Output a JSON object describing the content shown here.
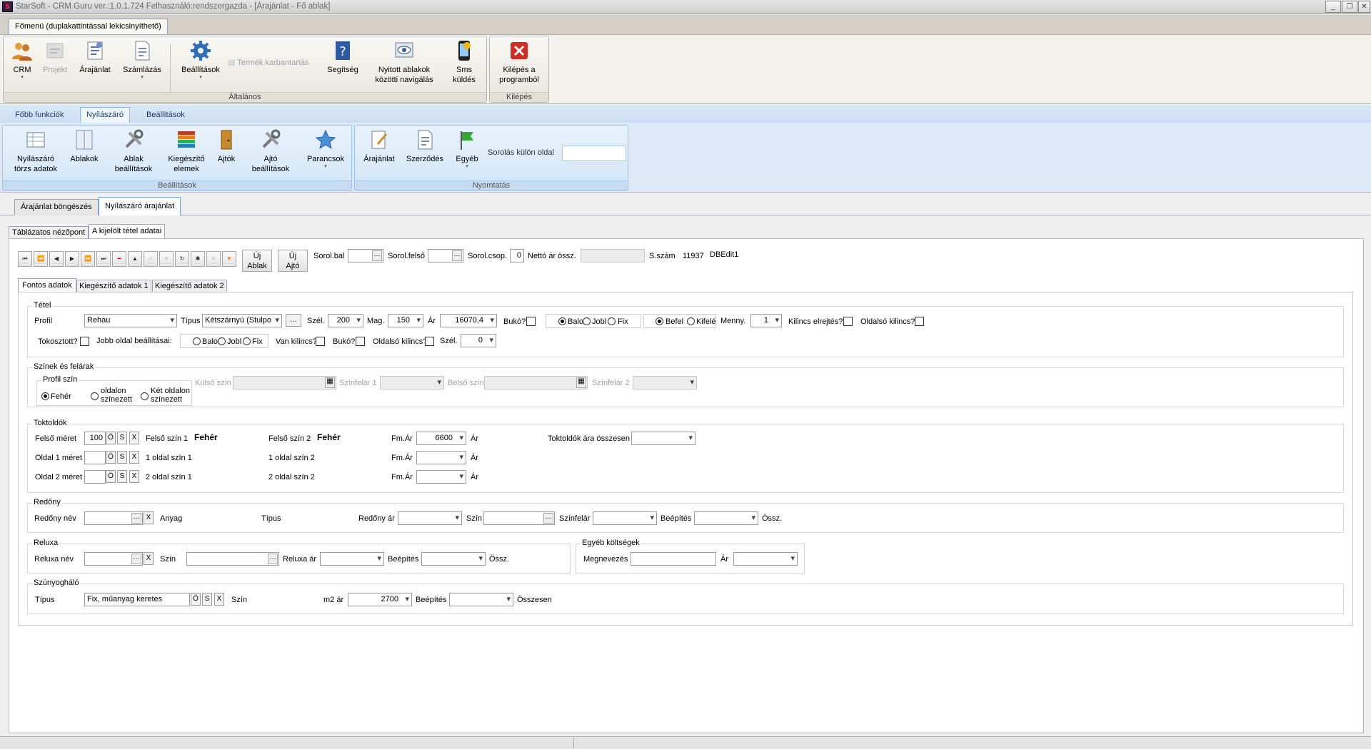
{
  "window": {
    "title": "StarSoft -  CRM Guru    ver.:1.0.1.724 Felhasználó:rendszergazda - [Árajánlat - Fő ablak]",
    "icon": "app-logo-icon",
    "min": "_",
    "max": "❐",
    "close": "✕"
  },
  "main_tab": "Főmenü (duplakattintással lekicsinyíthető)",
  "ribbon1": {
    "crm": "CRM",
    "projekt": "Projekt",
    "arajanlat": "Árajánlat",
    "szamlazas": "Számlázás",
    "beallitasok": "Beállítások",
    "termek": "Termék karbantartás",
    "segitseg": "Segítség",
    "nyitott1": "Nyitott ablakok",
    "nyitott2": "közötti navigálás",
    "sms1": "Sms",
    "sms2": "küldés",
    "kilepes1": "Kilépés a",
    "kilepes2": "programból",
    "group_altalanos": "Általános",
    "group_kilepes": "Kilépés"
  },
  "ribbon_tabs": [
    "Főbb funkciók",
    "Nyílászáró",
    "Beállítások"
  ],
  "ribbon2": {
    "torzs1": "Nyílászáró",
    "torzs2": "törzs adatok",
    "ablakok": "Ablakok",
    "ablakb1": "Ablak",
    "ablakb2": "beállítások",
    "kieg1": "Kiegészítő",
    "kieg2": "elemek",
    "ajtok": "Ajtók",
    "ajtob1": "Ajtó",
    "ajtob2": "beállítások",
    "parancsok": "Parancsok",
    "group_beall": "Beállítások",
    "arajanlat": "Árajánlat",
    "szerzodes": "Szerződés",
    "egyeb": "Egyéb",
    "sorolas": "Sorolás külön oldal",
    "group_nyomtatas": "Nyomtatás"
  },
  "doc_tabs": [
    "Árajánlat böngészés",
    "Nyílászáró árajánlat"
  ],
  "view_tabs": [
    "Táblázatos nézőpont",
    "A kijelölt tétel adatai"
  ],
  "toolbar": {
    "uj_ablak1": "Új",
    "uj_ablak2": "Ablak",
    "uj_ajto1": "Új",
    "uj_ajto2": "Ajtó",
    "sorol_bal": "Sorol.bal",
    "sorol_felso": "Sorol.felső",
    "sorol_csop": "Sorol.csop.",
    "sorol_csop_val": "0",
    "netto": "Nettó ár össz.",
    "sszam": "S.szám",
    "sszam_val": "11937",
    "dbedit": "DBEdit1"
  },
  "nav_buttons": [
    "⏮",
    "⏪",
    "◀",
    "▶",
    "⏩",
    "⏭",
    "━",
    "▲",
    "✓",
    "✕",
    "↻",
    "✱",
    "✳",
    "▼"
  ],
  "sub_tabs": [
    "Fontos adatok",
    "Kiegészítő adatok 1",
    "Kiegészítő adatok 2"
  ],
  "tetel": {
    "legend": "Tétel",
    "profil": "Profil",
    "profil_val": "Rehau",
    "tipus": "Típus",
    "tipus_val": "Kétszárnyú (Stulpo",
    "szel": "Szél.",
    "szel_val": "200",
    "mag": "Mag.",
    "mag_val": "150",
    "ar": "Ár",
    "ar_val": "16070,4",
    "buko": "Bukó?",
    "balo": "Balo",
    "jobb": "Jobl",
    "fix": "Fix",
    "befele": "Befel",
    "kifele": "Kifelé",
    "menny": "Menny.",
    "menny_val": "1",
    "kilincs_elrejt": "Kilincs elrejtés?",
    "oldalso_kilincs": "Oldalsó kilincs?",
    "tokosztott": "Tokosztott?",
    "jobb_oldal": "Jobb oldal beállításai:",
    "balo2": "Balo",
    "jobb2": "Jobl",
    "fix2": "Fix",
    "van_kilincs": "Van kilincs?",
    "buko2": "Bukó?",
    "oldalso2": "Oldalsó kilincs?",
    "szel2": "Szél.",
    "szel2_val": "0"
  },
  "szinek": {
    "legend": "Színek és felárak",
    "profil_szin": "Profil szín",
    "feher": "Fehér",
    "oldalon1": "oldalon",
    "oldalon2": "színezett",
    "ket1": "Két oldalon",
    "ket2": "színezett",
    "kulso": "Külső szín",
    "szinfelar1": "Színfelár 1",
    "belso": "Belső szín",
    "szinfelar2": "Színfelár 2"
  },
  "toktoldok": {
    "legend": "Toktoldók",
    "felso_meret": "Felső méret",
    "felso_val": "100",
    "felso_szin1": "Felső szín 1",
    "feher1": "Fehér",
    "felso_szin2": "Felső szín 2",
    "feher2": "Fehér",
    "fmar": "Fm.Ár",
    "fmar_val": "6600",
    "ar": "Ár",
    "osszesen": "Toktoldók ára összesen",
    "oldal1": "Oldal 1 méret",
    "oldal1_szin1": "1 oldal szín 1",
    "oldal1_szin2": "1 oldal szín 2",
    "oldal2": "Oldal 2 méret",
    "oldal2_szin1": "2 oldal szín 1",
    "oldal2_szin2": "2 oldal szín 2",
    "o": "Ö",
    "s": "S",
    "x": "X"
  },
  "redony": {
    "legend": "Redőny",
    "nev": "Redőny név",
    "anyag": "Anyag",
    "tipus": "Típus",
    "ar": "Redőny ár",
    "szin": "Szín",
    "szinfelar": "Színfelár",
    "beepites": "Beépítés",
    "ossz": "Össz."
  },
  "reluxa": {
    "legend": "Reluxa",
    "nev": "Reluxa név",
    "szin": "Szín",
    "ar": "Reluxa ár",
    "beepites": "Beépítés",
    "ossz": "Össz."
  },
  "egyeb": {
    "legend": "Egyéb költségek",
    "megnevezes": "Megnevezés",
    "ar": "Ár"
  },
  "szunyog": {
    "legend": "Szúnyogháló",
    "tipus": "Típus",
    "tipus_val": "Fix, műanyag keretes",
    "szin": "Szín",
    "m2ar": "m2 ár",
    "m2ar_val": "2700",
    "beepites": "Beépítés",
    "osszesen": "Összesen"
  }
}
